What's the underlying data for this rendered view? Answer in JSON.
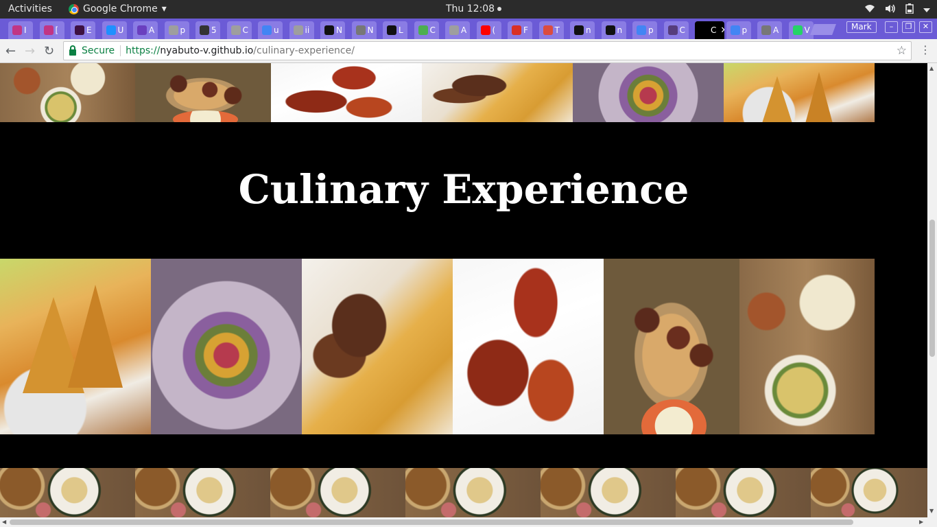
{
  "system_bar": {
    "activities": "Activities",
    "app_name": "Google Chrome",
    "app_menu_arrow": "▾",
    "clock": "Thu 12:08",
    "icons": [
      "wifi-icon",
      "volume-icon",
      "battery-icon",
      "power-menu-icon"
    ]
  },
  "tabs": [
    {
      "label": "I",
      "icon": "instagram-icon",
      "color": "#c13584"
    },
    {
      "label": "[",
      "icon": "instagram-icon",
      "color": "#c13584"
    },
    {
      "label": "E",
      "icon": "slack-icon",
      "color": "#3d1141"
    },
    {
      "label": "U",
      "icon": "cross-icon",
      "color": "#1e90ff"
    },
    {
      "label": "A",
      "icon": "list-icon",
      "color": "#6a3fbf"
    },
    {
      "label": "p",
      "icon": "page-icon",
      "color": "#9e9e9e"
    },
    {
      "label": "5",
      "icon": "camera-icon",
      "color": "#333333"
    },
    {
      "label": "C",
      "icon": "page-icon",
      "color": "#9e9e9e"
    },
    {
      "label": "u",
      "icon": "google-icon",
      "color": "#4285f4"
    },
    {
      "label": "ii",
      "icon": "page-icon",
      "color": "#9e9e9e"
    },
    {
      "label": "N",
      "icon": "github-icon",
      "color": "#111111"
    },
    {
      "label": "N",
      "icon": "pin-icon",
      "color": "#777777"
    },
    {
      "label": "L",
      "icon": "square-icon",
      "color": "#111111"
    },
    {
      "label": "C",
      "icon": "w3-icon",
      "color": "#4caf50"
    },
    {
      "label": "A",
      "icon": "page-icon",
      "color": "#9e9e9e"
    },
    {
      "label": "(",
      "icon": "youtube-icon",
      "color": "#ff0000"
    },
    {
      "label": "F",
      "icon": "gmail-icon",
      "color": "#d93025"
    },
    {
      "label": "T",
      "icon": "todoist-icon",
      "color": "#db4c3f"
    },
    {
      "label": "n",
      "icon": "github-icon",
      "color": "#111111"
    },
    {
      "label": "n",
      "icon": "github-icon",
      "color": "#111111"
    },
    {
      "label": "p",
      "icon": "google-icon",
      "color": "#4285f4"
    },
    {
      "label": "C",
      "icon": "bootstrap-icon",
      "color": "#563d7c"
    },
    {
      "label": "C",
      "icon": "page-icon",
      "color": "#000000",
      "active": true
    },
    {
      "label": "p",
      "icon": "google-icon",
      "color": "#4285f4"
    },
    {
      "label": "A",
      "icon": "bulb-icon",
      "color": "#777777"
    },
    {
      "label": "V",
      "icon": "whatsapp-icon",
      "color": "#25d366"
    }
  ],
  "window": {
    "profile": "Mark",
    "minimize": "–",
    "maximize": "❐",
    "close": "✕"
  },
  "toolbar": {
    "back": "←",
    "forward": "→",
    "reload": "↻",
    "secure_label": "Secure",
    "url_scheme": "https://",
    "url_host": "nyabuto-v.github.io",
    "url_path": "/culinary-experience/",
    "bookmark": "☆",
    "menu": "⋮"
  },
  "page": {
    "heading": "Culinary Experience"
  }
}
